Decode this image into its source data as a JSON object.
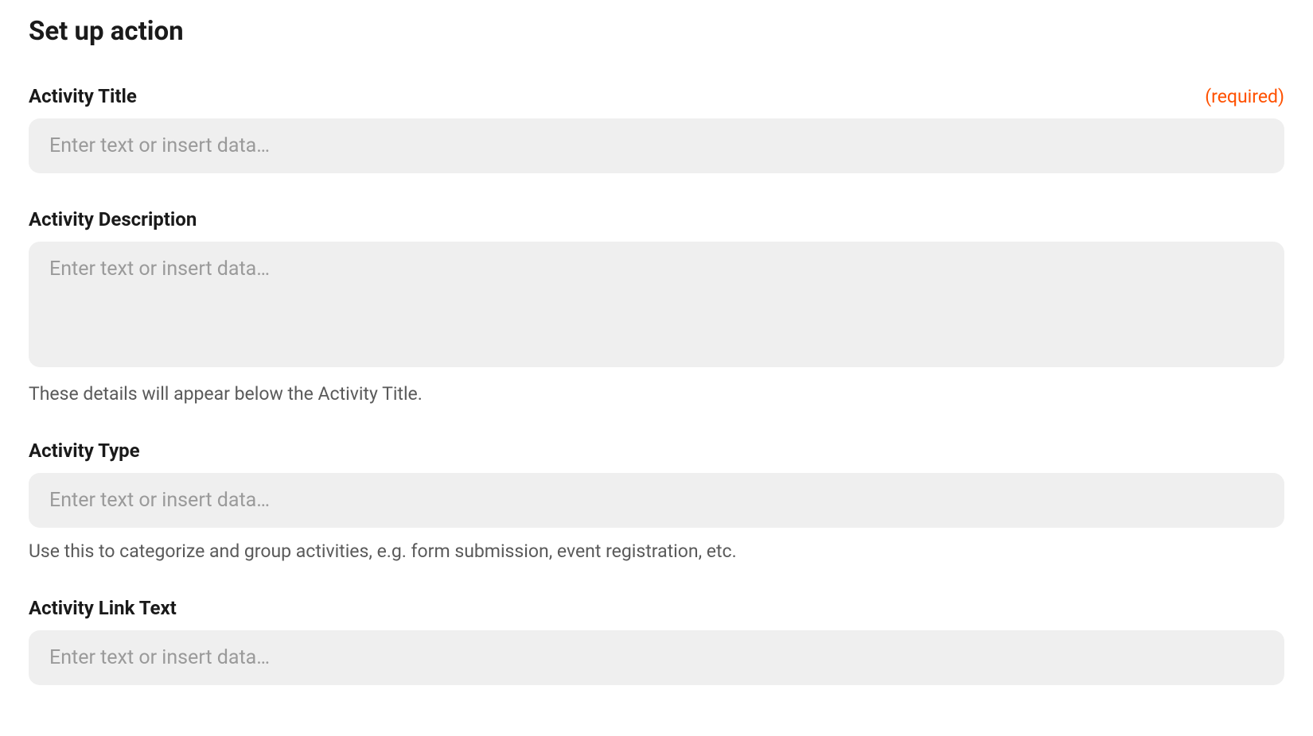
{
  "page": {
    "title": "Set up action"
  },
  "fields": {
    "activity_title": {
      "label": "Activity Title",
      "required_text": "(required)",
      "placeholder": "Enter text or insert data…",
      "value": ""
    },
    "activity_description": {
      "label": "Activity Description",
      "placeholder": "Enter text or insert data…",
      "value": "",
      "help": "These details will appear below the Activity Title."
    },
    "activity_type": {
      "label": "Activity Type",
      "placeholder": "Enter text or insert data…",
      "value": "",
      "help": "Use this to categorize and group activities, e.g. form submission, event registration, etc."
    },
    "activity_link_text": {
      "label": "Activity Link Text",
      "placeholder": "Enter text or insert data…",
      "value": ""
    }
  }
}
